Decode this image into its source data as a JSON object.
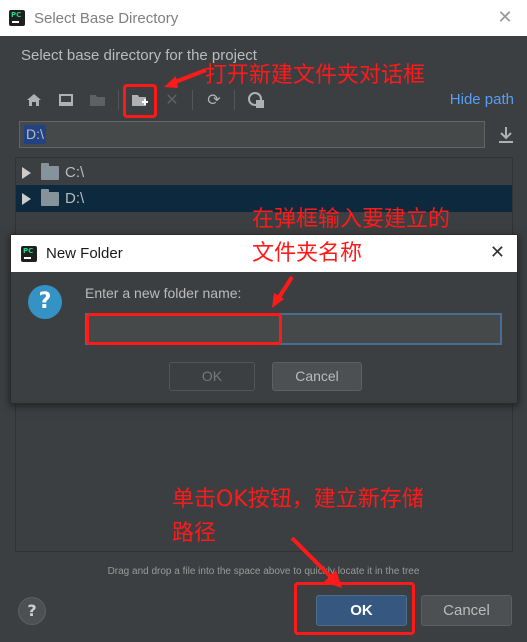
{
  "window": {
    "title": "Select Base Directory"
  },
  "subtitle": "Select base directory for the project",
  "toolbar": {
    "hide_path": "Hide path",
    "icons": [
      "home-icon",
      "desktop-icon",
      "project-folder-icon",
      "new-folder-icon",
      "delete-icon",
      "refresh-icon",
      "show-hidden-icon"
    ]
  },
  "path": {
    "value": "D:\\"
  },
  "tree": {
    "items": [
      {
        "label": "C:\\",
        "selected": false
      },
      {
        "label": "D:\\",
        "selected": true
      }
    ]
  },
  "hint": "Drag and drop a file into the space above to quickly locate it in the tree",
  "buttons": {
    "help": "?",
    "ok": "OK",
    "cancel": "Cancel"
  },
  "dialog": {
    "title": "New Folder",
    "prompt": "Enter a new folder name:",
    "ok": "OK",
    "cancel": "Cancel",
    "input_value": ""
  },
  "annotations": {
    "a1": "打开新建文件夹对话框",
    "a2_line1": "在弹框输入要建立的",
    "a2_line2": "文件夹名称",
    "a3_line1": "单击OK按钮，建立新存储",
    "a3_line2": "路径"
  },
  "colors": {
    "accent": "#589df6",
    "selection": "#214283",
    "annotation": "#ff1a1a",
    "ok_button": "#365880"
  }
}
